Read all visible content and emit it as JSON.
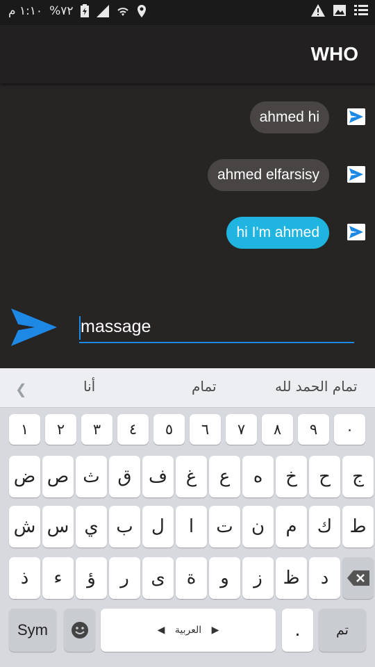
{
  "status_bar": {
    "time": "١:١٠ م",
    "battery": "%٧٢",
    "icons": [
      "location-icon",
      "wifi-icon",
      "signal-icon",
      "battery-charging-icon",
      "warning-icon",
      "image-icon",
      "list-icon"
    ]
  },
  "app_bar": {
    "title": "WHO"
  },
  "messages": [
    {
      "text": "ahmed hi",
      "style": "dark"
    },
    {
      "text": "ahmed elfarsisy",
      "style": "dark"
    },
    {
      "text": "hi I'm ahmed",
      "style": "cyan"
    }
  ],
  "composer": {
    "value": "massage"
  },
  "keyboard": {
    "suggestions": [
      "أنا",
      "تمام",
      "تمام الحمد لله"
    ],
    "numbers": [
      "١",
      "٢",
      "٣",
      "٤",
      "٥",
      "٦",
      "٧",
      "٨",
      "٩",
      "٠"
    ],
    "row_a": [
      "ض",
      "ص",
      "ث",
      "ق",
      "ف",
      "غ",
      "ع",
      "ه",
      "خ",
      "ح",
      "ج"
    ],
    "row_b": [
      "ش",
      "س",
      "ي",
      "ب",
      "ل",
      "ا",
      "ت",
      "ن",
      "م",
      "ك",
      "ط"
    ],
    "row_c": [
      "ذ",
      "ء",
      "ؤ",
      "ر",
      "ى",
      "ة",
      "و",
      "ز",
      "ظ",
      "د"
    ],
    "sym_label": "Sym",
    "space_label": "العربية",
    "dot_label": ".",
    "enter_label": "تم"
  },
  "colors": {
    "accent": "#1e88e5",
    "bubble_cyan": "#1fb5e0",
    "bubble_dark": "#4a4545",
    "background": "#272424"
  }
}
